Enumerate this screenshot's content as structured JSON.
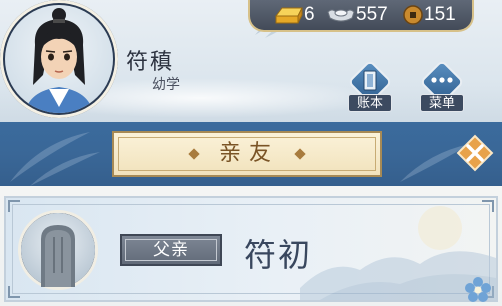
{
  "player": {
    "name": "符稹",
    "title": "幼学",
    "avatar_icon": "scholar-portrait-icon"
  },
  "currency": {
    "gold": {
      "icon": "gold-ingot-icon",
      "value": "6"
    },
    "silver": {
      "icon": "silver-ingot-icon",
      "value": "557"
    },
    "coin": {
      "icon": "copper-coin-icon",
      "value": "151"
    }
  },
  "buttons": {
    "ledger": {
      "label": "账本",
      "icon": "ledger-book-icon"
    },
    "menu": {
      "label": "菜单",
      "icon": "ellipsis-icon"
    }
  },
  "panel": {
    "title": "亲友",
    "close_icon": "close-icon"
  },
  "relatives": [
    {
      "relation": "父亲",
      "name": "符初",
      "portrait_icon": "tombstone-icon"
    }
  ],
  "colors": {
    "band_blue": "#3a6797",
    "plate_cream": "#f4e6c3",
    "title_brown": "#7a5426",
    "close_orange": "#e8a24a",
    "name_slate": "#39475e"
  }
}
